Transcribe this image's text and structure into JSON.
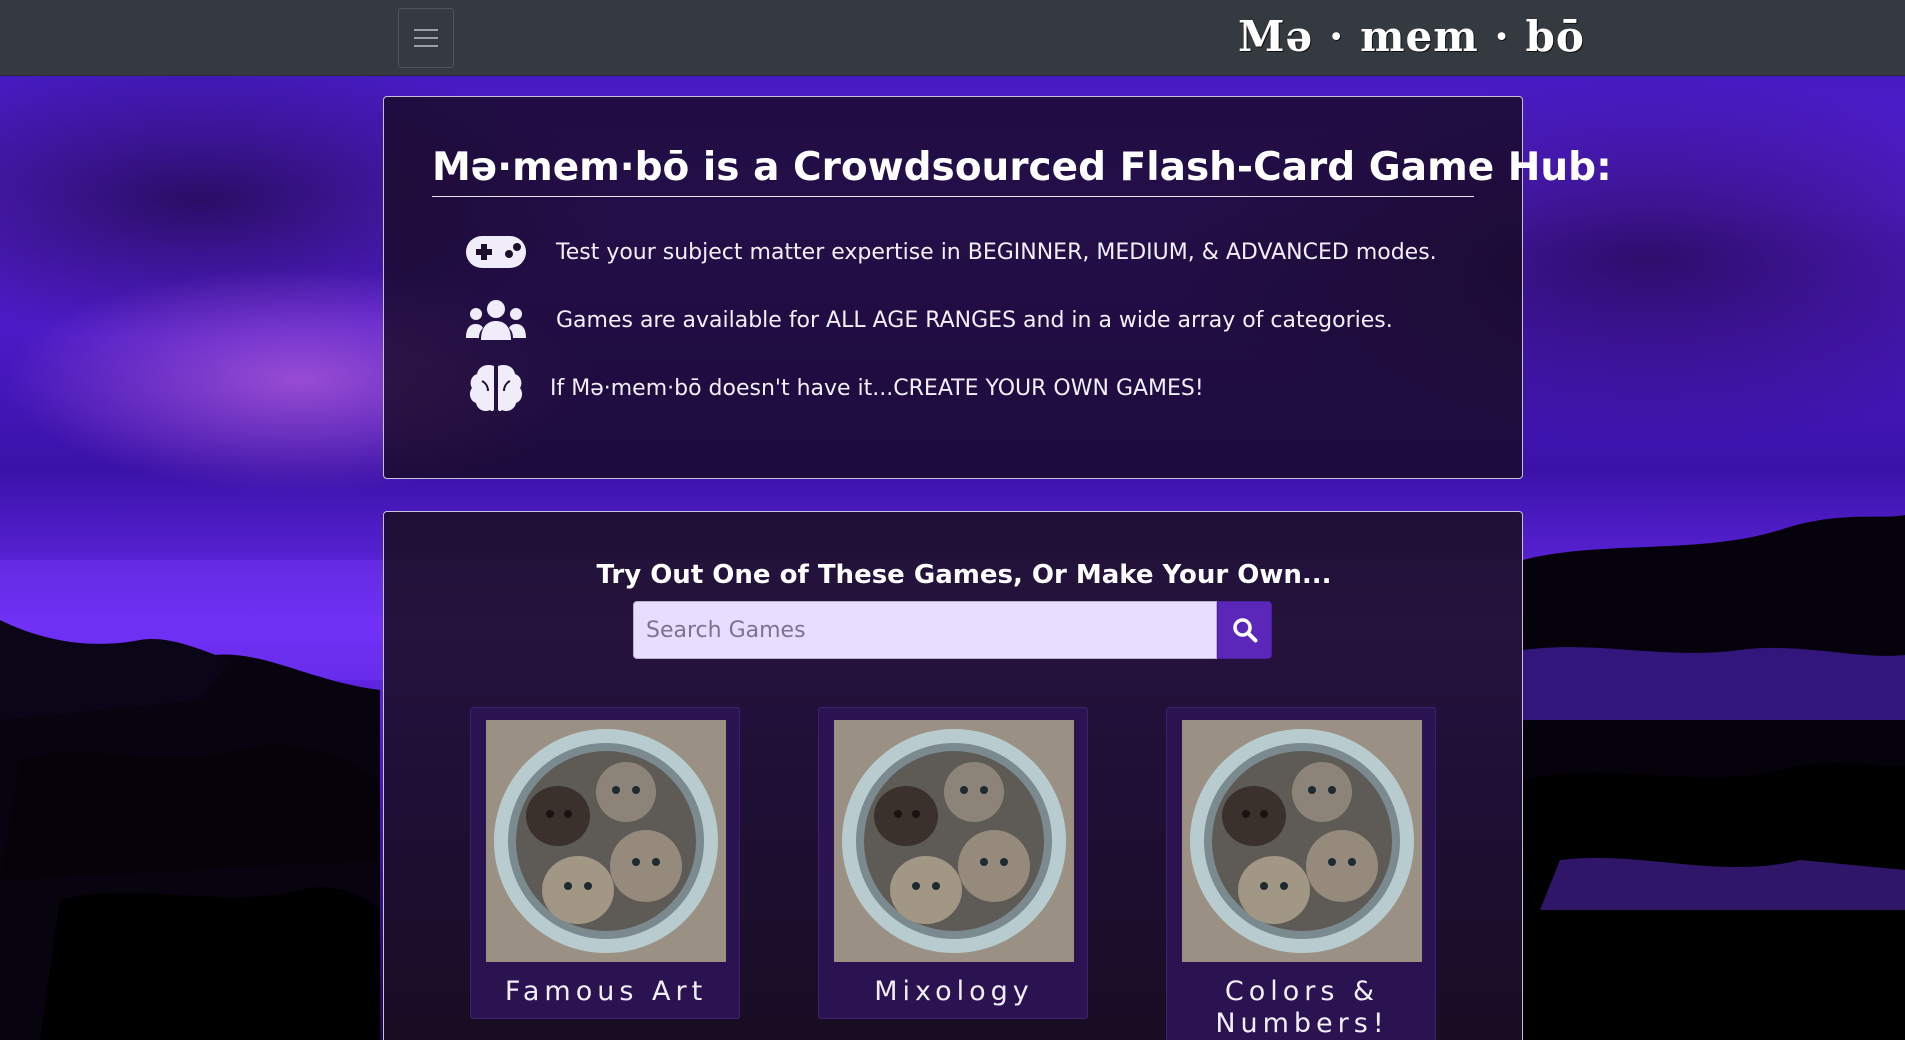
{
  "app": {
    "brand": "Mə · mem · bō"
  },
  "navbar": {
    "toggler_icon": "hamburger-menu-icon"
  },
  "info": {
    "title": "Mə·mem·bō is a Crowdsourced Flash-Card Game Hub:",
    "features": [
      {
        "icon": "gamepad-icon",
        "text": "Test your subject matter expertise in BEGINNER, MEDIUM, & ADVANCED modes."
      },
      {
        "icon": "users-icon",
        "text": "Games are available for ALL AGE RANGES and in a wide array of categories."
      },
      {
        "icon": "brain-icon",
        "text": "If Mə·mem·bō doesn't have it...CREATE YOUR OWN GAMES!"
      }
    ]
  },
  "games": {
    "heading": "Try Out One of These Games, Or Make Your Own...",
    "search_placeholder": "Search Games",
    "search_icon": "search-icon",
    "cards": [
      {
        "label": "Famous Art",
        "image": "kittens-in-bucket-image"
      },
      {
        "label": "Mixology",
        "image": "kittens-in-bucket-image"
      },
      {
        "label": "Colors & Numbers!",
        "image": "kittens-in-bucket-image"
      }
    ]
  },
  "colors": {
    "navbar": "#343a40",
    "accent": "#5b27b8",
    "search_bg": "#e8dcff",
    "card_bg": "#2a1350"
  }
}
